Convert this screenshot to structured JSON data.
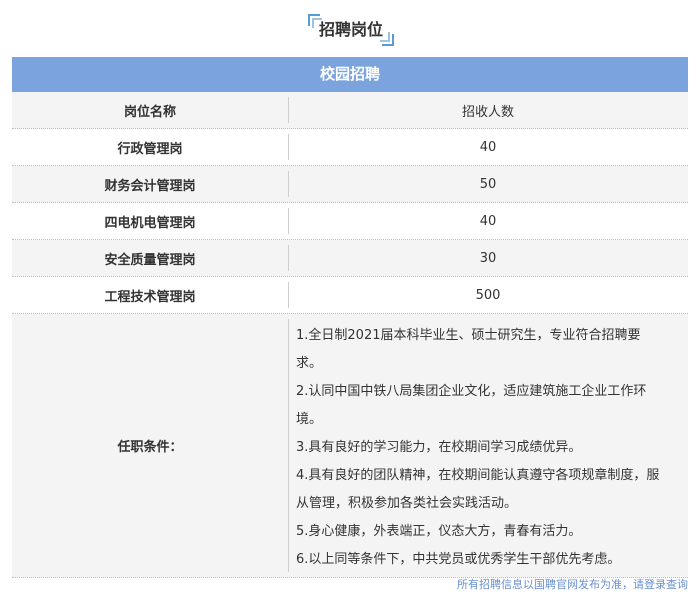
{
  "page_title": "招聘岗位",
  "table": {
    "banner": "校园招聘",
    "header": {
      "col1": "岗位名称",
      "col2": "招收人数"
    },
    "rows": [
      {
        "name": "行政管理岗",
        "count": "40"
      },
      {
        "name": "财务会计管理岗",
        "count": "50"
      },
      {
        "name": "四电机电管理岗",
        "count": "40"
      },
      {
        "name": "安全质量管理岗",
        "count": "30"
      },
      {
        "name": "工程技术管理岗",
        "count": "500"
      }
    ],
    "requirements": {
      "label": "任职条件：",
      "items": [
        "1.全日制2021届本科毕业生、硕士研究生，专业符合招聘要求。",
        "2.认同中国中铁八局集团企业文化，适应建筑施工企业工作环境。",
        "3.具有良好的学习能力，在校期间学习成绩优异。",
        "4.具有良好的团队精神，在校期间能认真遵守各项规章制度，服从管理，积极参加各类社会实践活动。",
        "5.身心健康，外表端正，仪态大方，青春有活力。",
        "6.以上同等条件下，中共党员或优秀学生干部优先考虑。"
      ]
    }
  },
  "footnote": "所有招聘信息以国聘官网发布为准，请登录查询"
}
